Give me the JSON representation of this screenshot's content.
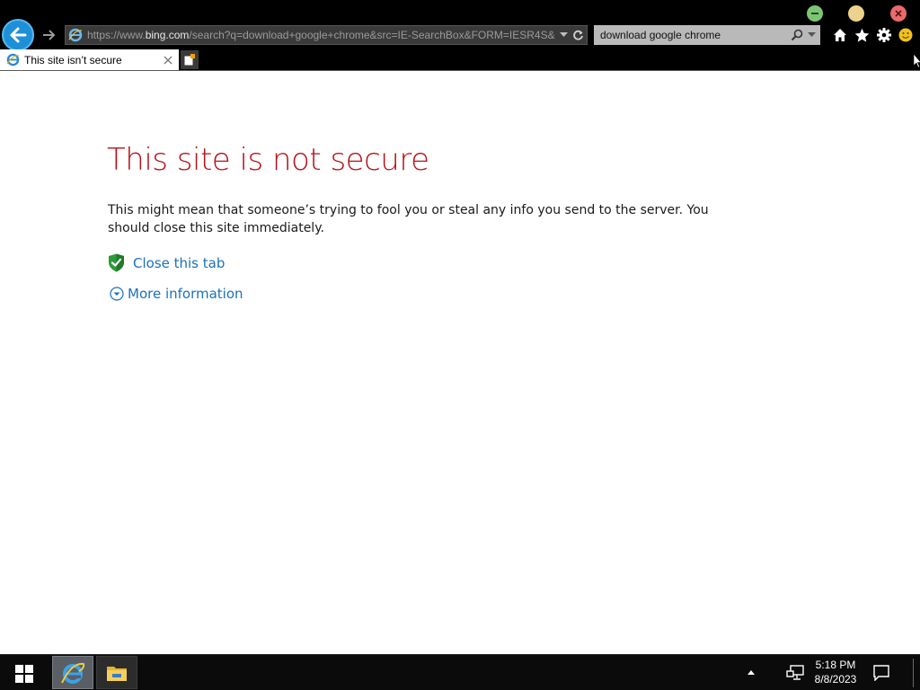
{
  "browser": {
    "address_bar": {
      "url_prefix": "https://www.",
      "url_domain": "bing.com",
      "url_rest": "/search?q=download+google+chrome&src=IE-SearchBox&FORM=IESR4S&"
    },
    "search_box": {
      "value": "download google chrome"
    },
    "tab": {
      "title": "This site isn’t secure"
    },
    "icons": {
      "back": "back-arrow-icon",
      "forward": "forward-arrow-icon",
      "refresh": "refresh-icon",
      "home": "home-icon",
      "favorites": "star-icon",
      "settings": "gear-icon",
      "feedback": "smiley-icon"
    }
  },
  "page": {
    "title": "This site is not secure",
    "message": "This might mean that someone’s trying to fool you or steal any info you send to the server. You should close this site immediately.",
    "close_tab_label": "Close this tab",
    "more_info_label": "More information"
  },
  "taskbar": {
    "time": "5:18 PM",
    "date": "8/8/2023"
  },
  "colors": {
    "title_red": "#b4121a",
    "link_blue": "#1a72ba",
    "chrome_black": "#000000",
    "back_button_blue": "#1e90d8",
    "shield_green": "#2e9a3a"
  }
}
